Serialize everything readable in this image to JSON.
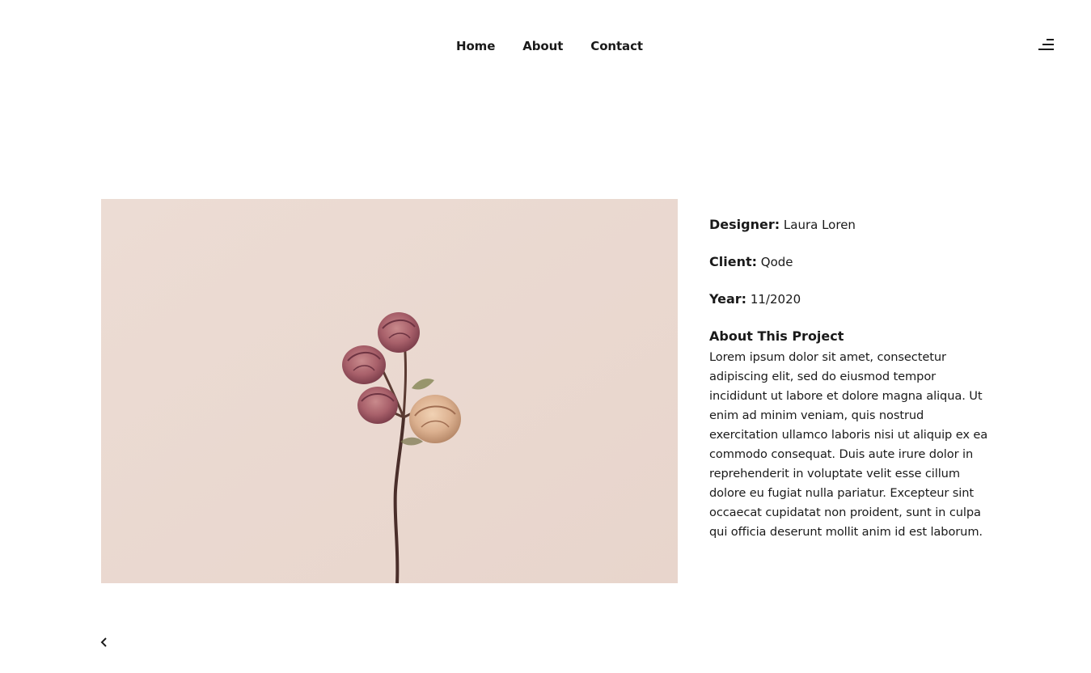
{
  "nav": {
    "items": [
      {
        "label": "Home"
      },
      {
        "label": "About"
      },
      {
        "label": "Contact"
      }
    ]
  },
  "header": {
    "menu_icon": "hamburger-menu-icon"
  },
  "project": {
    "image": "dried-roses-photo",
    "designer_label": "Designer:",
    "designer": "Laura Loren",
    "client_label": "Client:",
    "client": "Qode",
    "year_label": "Year:",
    "year": "11/2020",
    "about_title": "About This Project",
    "about_text": "Lorem ipsum dolor sit amet, consectetur adipiscing elit, sed do eiusmod tempor incididunt ut labore et dolore magna aliqua. Ut enim ad minim veniam, quis nostrud exercitation ullamco laboris nisi ut aliquip ex ea commodo consequat. Duis aute irure dolor in reprehenderit in voluptate velit esse cillum dolore eu fugiat nulla pariatur. Excepteur sint occaecat cupidatat non proident, sunt in culpa qui officia deserunt mollit anim id est laborum."
  },
  "pagination": {
    "prev_icon": "chevron-left-icon"
  },
  "colors": {
    "background": "#ffffff",
    "text": "#1a1a1a",
    "photo_bg": "#ead9d1"
  }
}
